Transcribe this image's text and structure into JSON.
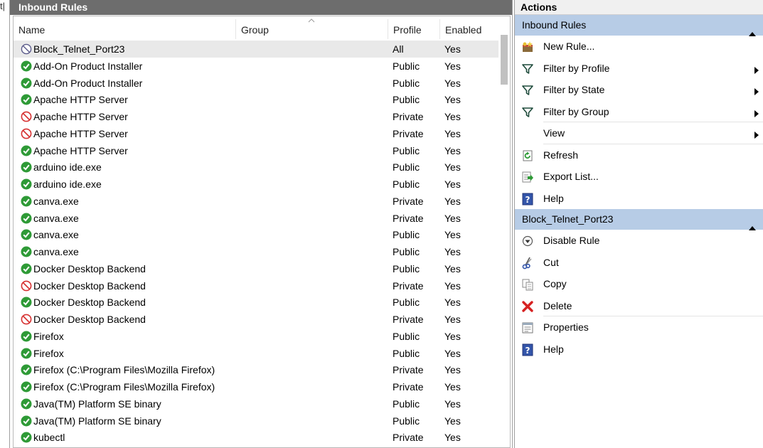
{
  "left_edge_char": "t|",
  "left_panel": {
    "title": "Inbound Rules",
    "columns": [
      "Name",
      "Group",
      "Profile",
      "Enabled"
    ],
    "rows": [
      {
        "name": "Block_Telnet_Port23",
        "profile": "All",
        "enabled": "Yes",
        "icon": "disabled-rule-icon",
        "selected": true
      },
      {
        "name": "Add-On Product Installer",
        "profile": "Public",
        "enabled": "Yes",
        "icon": "allow-rule-icon"
      },
      {
        "name": "Add-On Product Installer",
        "profile": "Public",
        "enabled": "Yes",
        "icon": "allow-rule-icon"
      },
      {
        "name": "Apache HTTP Server",
        "profile": "Public",
        "enabled": "Yes",
        "icon": "allow-rule-icon"
      },
      {
        "name": "Apache HTTP Server",
        "profile": "Private",
        "enabled": "Yes",
        "icon": "block-rule-icon"
      },
      {
        "name": "Apache HTTP Server",
        "profile": "Private",
        "enabled": "Yes",
        "icon": "block-rule-icon"
      },
      {
        "name": "Apache HTTP Server",
        "profile": "Public",
        "enabled": "Yes",
        "icon": "allow-rule-icon"
      },
      {
        "name": "arduino ide.exe",
        "profile": "Public",
        "enabled": "Yes",
        "icon": "allow-rule-icon"
      },
      {
        "name": "arduino ide.exe",
        "profile": "Public",
        "enabled": "Yes",
        "icon": "allow-rule-icon"
      },
      {
        "name": "canva.exe",
        "profile": "Private",
        "enabled": "Yes",
        "icon": "allow-rule-icon"
      },
      {
        "name": "canva.exe",
        "profile": "Private",
        "enabled": "Yes",
        "icon": "allow-rule-icon"
      },
      {
        "name": "canva.exe",
        "profile": "Public",
        "enabled": "Yes",
        "icon": "allow-rule-icon"
      },
      {
        "name": "canva.exe",
        "profile": "Public",
        "enabled": "Yes",
        "icon": "allow-rule-icon"
      },
      {
        "name": "Docker Desktop Backend",
        "profile": "Public",
        "enabled": "Yes",
        "icon": "allow-rule-icon"
      },
      {
        "name": "Docker Desktop Backend",
        "profile": "Private",
        "enabled": "Yes",
        "icon": "block-rule-icon"
      },
      {
        "name": "Docker Desktop Backend",
        "profile": "Public",
        "enabled": "Yes",
        "icon": "allow-rule-icon"
      },
      {
        "name": "Docker Desktop Backend",
        "profile": "Private",
        "enabled": "Yes",
        "icon": "block-rule-icon"
      },
      {
        "name": "Firefox",
        "profile": "Public",
        "enabled": "Yes",
        "icon": "allow-rule-icon"
      },
      {
        "name": "Firefox",
        "profile": "Public",
        "enabled": "Yes",
        "icon": "allow-rule-icon"
      },
      {
        "name": "Firefox (C:\\Program Files\\Mozilla Firefox)",
        "profile": "Private",
        "enabled": "Yes",
        "icon": "allow-rule-icon"
      },
      {
        "name": "Firefox (C:\\Program Files\\Mozilla Firefox)",
        "profile": "Private",
        "enabled": "Yes",
        "icon": "allow-rule-icon"
      },
      {
        "name": "Java(TM) Platform SE binary",
        "profile": "Public",
        "enabled": "Yes",
        "icon": "allow-rule-icon"
      },
      {
        "name": "Java(TM) Platform SE binary",
        "profile": "Public",
        "enabled": "Yes",
        "icon": "allow-rule-icon"
      },
      {
        "name": "kubectl",
        "profile": "Private",
        "enabled": "Yes",
        "icon": "allow-rule-icon"
      },
      {
        "name": "",
        "profile": "",
        "enabled": "",
        "icon": "allow-rule-icon"
      }
    ]
  },
  "right_panel": {
    "title": "Actions",
    "sections": [
      {
        "header": "Inbound Rules",
        "items": [
          {
            "label": "New Rule...",
            "icon": "new-rule-icon",
            "submenu": false,
            "divider": false
          },
          {
            "label": "Filter by Profile",
            "icon": "filter-icon",
            "submenu": true,
            "divider": false
          },
          {
            "label": "Filter by State",
            "icon": "filter-icon",
            "submenu": true,
            "divider": false
          },
          {
            "label": "Filter by Group",
            "icon": "filter-icon",
            "submenu": true,
            "divider": true
          },
          {
            "label": "View",
            "icon": "",
            "submenu": true,
            "divider": true
          },
          {
            "label": "Refresh",
            "icon": "refresh-icon",
            "submenu": false,
            "divider": false
          },
          {
            "label": "Export List...",
            "icon": "export-list-icon",
            "submenu": false,
            "divider": false
          },
          {
            "label": "Help",
            "icon": "help-icon",
            "submenu": false,
            "divider": false
          }
        ]
      },
      {
        "header": "Block_Telnet_Port23",
        "items": [
          {
            "label": "Disable Rule",
            "icon": "disable-rule-icon",
            "submenu": false,
            "divider": false
          },
          {
            "label": "Cut",
            "icon": "cut-icon",
            "submenu": false,
            "divider": false
          },
          {
            "label": "Copy",
            "icon": "copy-icon",
            "submenu": false,
            "divider": false
          },
          {
            "label": "Delete",
            "icon": "delete-icon",
            "submenu": false,
            "divider": true
          },
          {
            "label": "Properties",
            "icon": "properties-icon",
            "submenu": false,
            "divider": false
          },
          {
            "label": "Help",
            "icon": "help-icon",
            "submenu": false,
            "divider": false
          }
        ]
      }
    ]
  },
  "colors": {
    "title_bar": "#6d6d6d",
    "section_header": "#b7cce6",
    "selected_row": "#e9e9e9",
    "allow_green": "#2e9a36",
    "block_red": "#d63030",
    "disabled_gray": "#5a5a8a"
  }
}
